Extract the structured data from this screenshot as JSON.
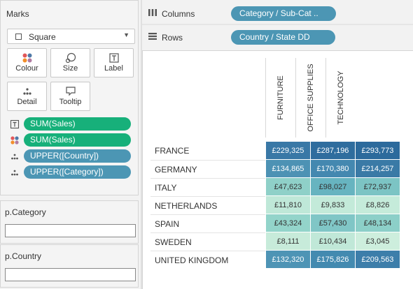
{
  "marks": {
    "title": "Marks",
    "mark_type": "Square",
    "buttons": [
      {
        "label": "Colour",
        "icon": "colour-dots-icon"
      },
      {
        "label": "Size",
        "icon": "size-circle-icon"
      },
      {
        "label": "Label",
        "icon": "label-t-icon"
      },
      {
        "label": "Detail",
        "icon": "detail-dots-icon"
      },
      {
        "label": "Tooltip",
        "icon": "tooltip-bubble-icon"
      }
    ],
    "fields": [
      {
        "label": "SUM(Sales)",
        "icon": "label-t-icon",
        "color": "#17b07a"
      },
      {
        "label": "SUM(Sales)",
        "icon": "colour-dots-icon",
        "color": "#17b07a"
      },
      {
        "label": "UPPER([Country])",
        "icon": "detail-dots-icon",
        "color": "#4c96b4"
      },
      {
        "label": "UPPER([Category])",
        "icon": "detail-dots-icon",
        "color": "#4c96b4"
      }
    ]
  },
  "parameters": [
    {
      "title": "p.Category",
      "value": ""
    },
    {
      "title": "p.Country",
      "value": ""
    }
  ],
  "shelves": {
    "columns": {
      "label": "Columns",
      "pill": "Category / Sub-Cat .."
    },
    "rows": {
      "label": "Rows",
      "pill": "Country / State DD"
    }
  },
  "table": {
    "columns": [
      "FURNITURE",
      "OFFICE SUPPLIES",
      "TECHNOLOGY"
    ],
    "rows": [
      {
        "name": "FRANCE",
        "cells": [
          "£229,325",
          "£287,196",
          "£293,773"
        ]
      },
      {
        "name": "GERMANY",
        "cells": [
          "£134,865",
          "£170,380",
          "£214,257"
        ]
      },
      {
        "name": "ITALY",
        "cells": [
          "£47,623",
          "£98,027",
          "£72,937"
        ]
      },
      {
        "name": "NETHERLANDS",
        "cells": [
          "£11,810",
          "£9,833",
          "£8,826"
        ]
      },
      {
        "name": "SPAIN",
        "cells": [
          "£43,324",
          "£57,430",
          "£48,134"
        ]
      },
      {
        "name": "SWEDEN",
        "cells": [
          "£8,111",
          "£10,434",
          "£3,045"
        ]
      },
      {
        "name": "UNITED KINGDOM",
        "cells": [
          "£132,320",
          "£175,826",
          "£209,563"
        ]
      }
    ],
    "cell_colors": [
      [
        "#3978a6",
        "#2f6d9e",
        "#2c6a9c"
      ],
      [
        "#4d92b4",
        "#4488b0",
        "#3a7aa6"
      ],
      [
        "#8fd0c8",
        "#67b4c0",
        "#7cc4c4"
      ],
      [
        "#bfe8d8",
        "#c3ead9",
        "#c5ebda"
      ],
      [
        "#93d4ca",
        "#80c6c6",
        "#8ccfc8"
      ],
      [
        "#c7ebda",
        "#c0e8d8",
        "#cdeedd"
      ],
      [
        "#4e94b5",
        "#438ab0",
        "#3d7eaa"
      ]
    ],
    "cell_text_light": [
      [
        false,
        false,
        false
      ],
      [
        false,
        false,
        false
      ],
      [
        true,
        true,
        true
      ],
      [
        true,
        true,
        true
      ],
      [
        true,
        true,
        true
      ],
      [
        true,
        true,
        true
      ],
      [
        false,
        false,
        false
      ]
    ]
  }
}
